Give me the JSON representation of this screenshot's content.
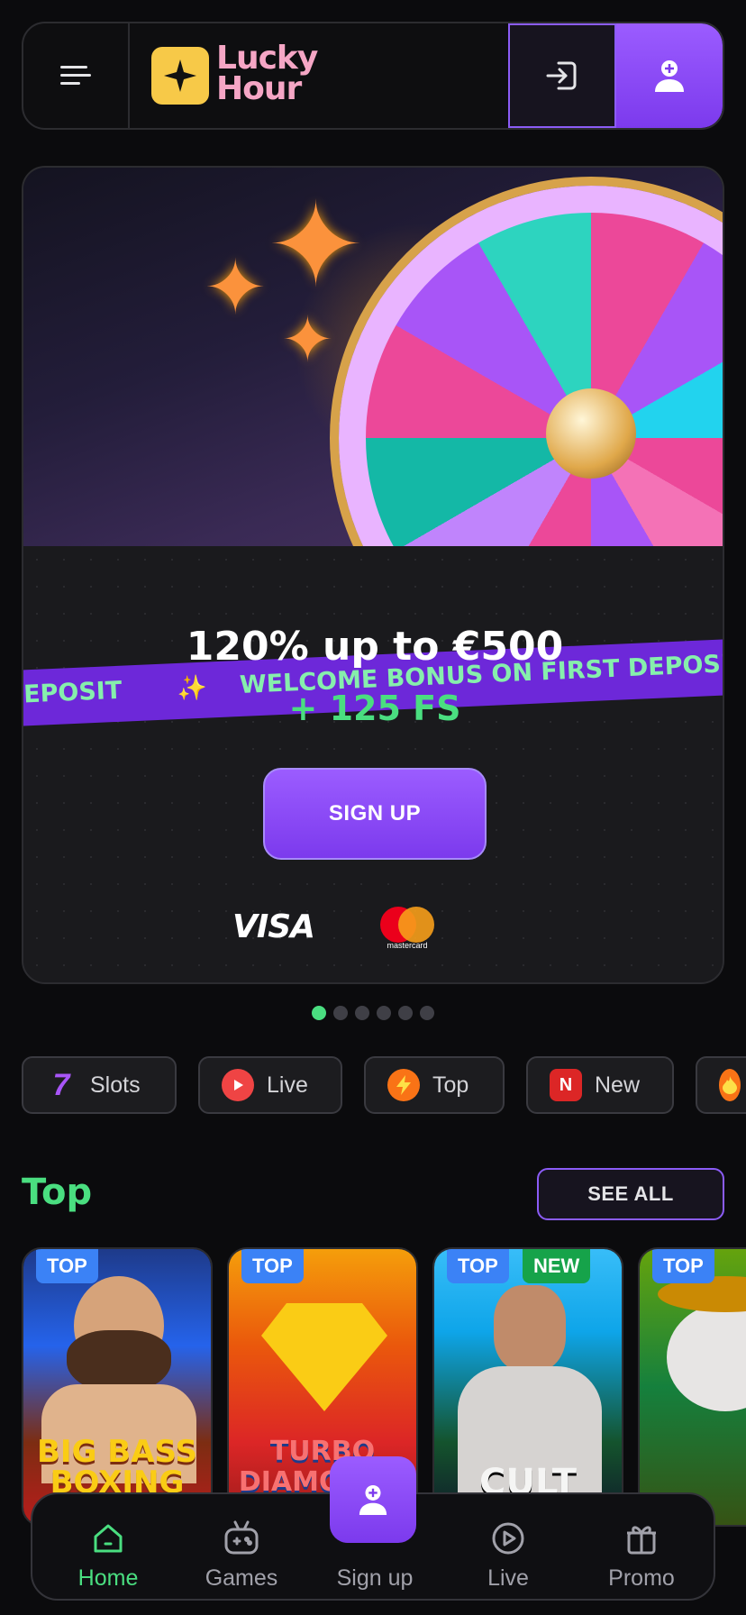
{
  "header": {
    "logo_line1": "Lucky",
    "logo_line2": "Hour",
    "menu_icon": "hamburger-icon",
    "login_icon": "login-icon",
    "signup_icon": "user-plus-icon"
  },
  "banner": {
    "ribbon_text_1": "EPOSIT",
    "ribbon_sparkle": "✨",
    "ribbon_text_2": "WELCOME BONUS ON FIRST DEPOSI",
    "headline": "120% up to €500",
    "subline": "+ 125 FS",
    "cta_label": "SIGN UP",
    "payment_1": "VISA",
    "payment_2_label": "mastercard",
    "slides_total": 6,
    "slide_active": 1
  },
  "categories": [
    {
      "label": "Slots",
      "icon": "seven-icon",
      "color": "#a855f7"
    },
    {
      "label": "Live",
      "icon": "live-play-icon",
      "color": "#ef4444"
    },
    {
      "label": "Top",
      "icon": "lightning-icon",
      "color": "#f97316"
    },
    {
      "label": "New",
      "icon": "new-badge-icon",
      "color": "#dc2626"
    },
    {
      "label": "",
      "icon": "fire-icon",
      "color": "#f97316"
    }
  ],
  "top_section": {
    "title": "Top",
    "see_all": "SEE ALL",
    "badge_top": "TOP",
    "badge_new": "NEW",
    "games": [
      {
        "title": "BIG BASS BOXING"
      },
      {
        "title": "TURBO DIAMONDS"
      },
      {
        "title": "CULT"
      },
      {
        "title": ""
      }
    ]
  },
  "bottom_nav": {
    "home": "Home",
    "games": "Games",
    "signup": "Sign up",
    "live": "Live",
    "promo": "Promo"
  },
  "colors": {
    "accent_purple": "#7c3aed",
    "accent_green": "#4ade80",
    "background": "#0b0b0d"
  }
}
